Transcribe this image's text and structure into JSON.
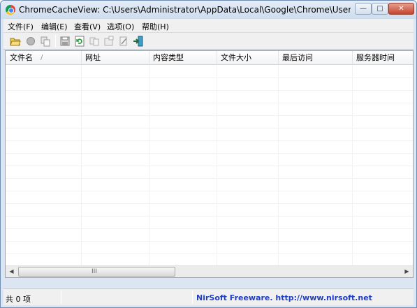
{
  "window": {
    "title": "ChromeCacheView:  C:\\Users\\Administrator\\AppData\\Local\\Google\\Chrome\\User Data\\De...",
    "controls": {
      "minimize": "—",
      "maximize": "□",
      "close": "✕"
    }
  },
  "menu": [
    {
      "label": "文件(F)"
    },
    {
      "label": "编辑(E)"
    },
    {
      "label": "查看(V)"
    },
    {
      "label": "选项(O)"
    },
    {
      "label": "帮助(H)"
    }
  ],
  "toolbar": {
    "buttons": [
      "open-folder-icon",
      "stop-icon",
      "copy-icon",
      "save-icon",
      "refresh-icon",
      "copy-files-icon",
      "properties-icon",
      "html-report-icon",
      "exit-icon"
    ]
  },
  "list": {
    "columns": [
      {
        "label": "文件名"
      },
      {
        "label": "网址"
      },
      {
        "label": "内容类型"
      },
      {
        "label": "文件大小"
      },
      {
        "label": "最后访问"
      },
      {
        "label": "服务器时间"
      }
    ],
    "sort_indicator": "/",
    "rows": []
  },
  "scrollbar": {
    "grip": "III"
  },
  "status": {
    "count": "共 0 项",
    "credit": "NirSoft Freeware.  http://www.nirsoft.net"
  },
  "colors": {
    "credit_text": "#1f3fc0",
    "close_button": "#c6432e"
  }
}
